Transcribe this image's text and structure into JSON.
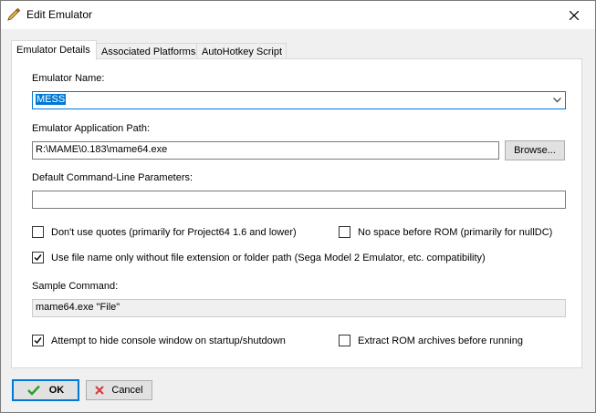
{
  "window": {
    "title": "Edit Emulator"
  },
  "tabs": [
    {
      "label": "Emulator Details"
    },
    {
      "label": "Associated Platforms"
    },
    {
      "label": "AutoHotkey Script"
    }
  ],
  "form": {
    "name_label": "Emulator Name:",
    "name_value": "MESS",
    "path_label": "Emulator Application Path:",
    "path_value": "R:\\MAME\\0.183\\mame64.exe",
    "browse_label": "Browse...",
    "params_label": "Default Command-Line Parameters:",
    "params_value": "",
    "checkboxes": {
      "no_quotes": {
        "label": "Don't use quotes (primarily for Project64 1.6 and lower)",
        "checked": false
      },
      "no_space": {
        "label": "No space before ROM (primarily for nullDC)",
        "checked": false
      },
      "file_name_only": {
        "label": "Use file name only without file extension or folder path (Sega Model 2 Emulator, etc. compatibility)",
        "checked": true
      },
      "hide_console": {
        "label": "Attempt to hide console window on startup/shutdown",
        "checked": true
      },
      "extract_rom": {
        "label": "Extract ROM archives before running",
        "checked": false
      }
    },
    "sample_label": "Sample Command:",
    "sample_value": "mame64.exe \"File\""
  },
  "buttons": {
    "ok_label": "OK",
    "cancel_label": "Cancel"
  },
  "colors": {
    "accent": "#0078d7",
    "ok_check": "#2a9d2a",
    "cancel_x": "#d23a3a"
  },
  "icons": {
    "title": "pencil-icon",
    "close": "close-icon",
    "dropdown": "chevron-down-icon",
    "ok": "checkmark-icon",
    "cancel": "x-icon"
  }
}
